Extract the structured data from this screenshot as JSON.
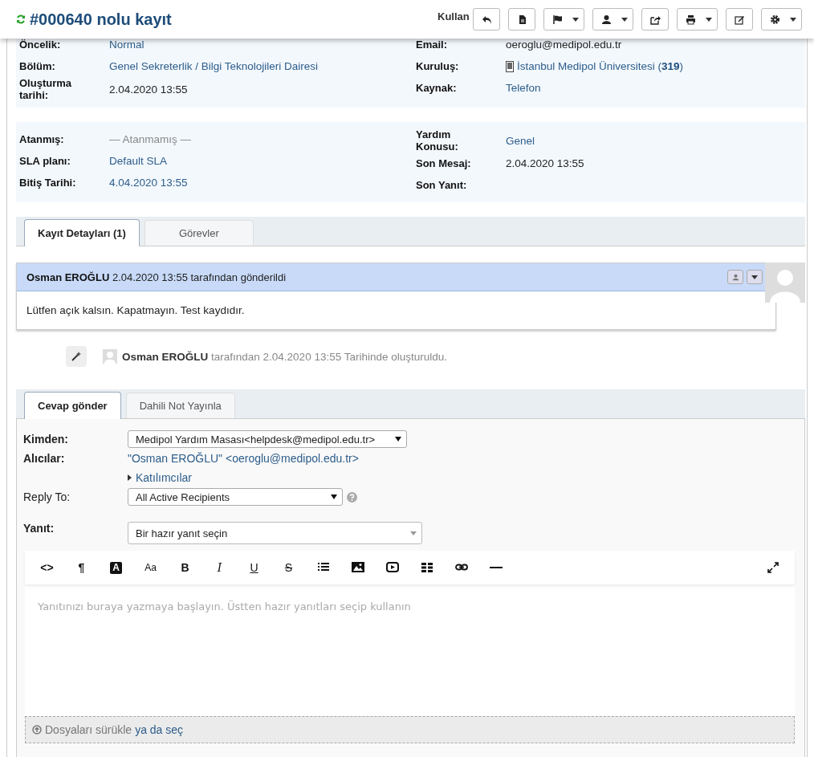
{
  "header": {
    "title": "#000640 nolu kayıt",
    "hidden_label": "Kullan",
    "buttons": [
      {
        "kind": "reply",
        "caret": false
      },
      {
        "kind": "document",
        "caret": false
      },
      {
        "kind": "flag",
        "caret": true
      },
      {
        "kind": "person",
        "caret": true
      },
      {
        "kind": "share",
        "caret": false
      },
      {
        "kind": "print",
        "caret": true
      },
      {
        "kind": "edit",
        "caret": false
      },
      {
        "kind": "gear",
        "caret": true
      }
    ]
  },
  "info_blocks": [
    {
      "left": [
        {
          "label": "Öncelik:",
          "value": "Normal",
          "kind": "link"
        },
        {
          "label": "Bölüm:",
          "value": "Genel Sekreterlik / Bilgi Teknolojileri Dairesi",
          "kind": "link"
        },
        {
          "label": "Oluşturma tarihi:",
          "value": "2.04.2020 13:55",
          "kind": "plain"
        }
      ],
      "right": [
        {
          "label": "Email:",
          "value": "oeroglu@medipol.edu.tr",
          "kind": "plain"
        },
        {
          "label": "Kuruluş:",
          "value": "İstanbul Medipol Üniversitesi (**319**)",
          "kind": "org"
        },
        {
          "label": "Kaynak:",
          "value": "Telefon",
          "kind": "link"
        }
      ]
    },
    {
      "left": [
        {
          "label": "Atanmış:",
          "value": "— Atanmamış —",
          "kind": "muted"
        },
        {
          "label": "SLA planı:",
          "value": "Default SLA",
          "kind": "link"
        },
        {
          "label": "Bitiş Tarihi:",
          "value": "4.04.2020 13:55",
          "kind": "link"
        }
      ],
      "right": [
        {
          "label": "Yardım Konusu:",
          "value": "Genel",
          "kind": "link"
        },
        {
          "label": "Son Mesaj:",
          "value": "2.04.2020 13:55",
          "kind": "plain"
        },
        {
          "label": "Son Yanıt:"
        }
      ]
    }
  ],
  "thread_tabs": [
    {
      "label": "Kayıt Detayları (1)",
      "selected": true
    },
    {
      "label": "Görevler",
      "selected": false
    }
  ],
  "message": {
    "header": "**Osman EROĞLU** 2.04.2020 13:55 tarafından gönderildi",
    "body": "Lütfen açık kalsın. Kapatmayın. Test kaydıdır."
  },
  "event": {
    "text": "**Osman EROĞLU** tarafından 2.04.2020 13:55 Tarihinde oluşturuldu."
  },
  "reply_tabs": [
    {
      "label": "Cevap gönder",
      "selected": true
    },
    {
      "label": "Dahili Not Yayınla",
      "selected": false
    }
  ],
  "form": {
    "from": {
      "label": "Kimden:",
      "value": "Medipol Yardım Masası<helpdesk@medipol.edu.tr>"
    },
    "recipients": {
      "label": "Alıcılar:",
      "value": "\"Osman EROĞLU\" <oeroglu@medipol.edu.tr>",
      "collaborators": "Katılımcılar"
    },
    "reply_to": {
      "label": "Reply To:",
      "value": "All Active Recipients"
    },
    "response": {
      "label": "Yanıt:",
      "value": "Bir hazır yanıt seçin"
    }
  },
  "editor": {
    "tools": [
      {
        "kind": "text",
        "label": "<>"
      },
      {
        "kind": "text",
        "label": "¶"
      },
      {
        "kind": "boxed",
        "label": "A"
      },
      {
        "kind": "small",
        "label": "Aa"
      },
      {
        "kind": "bold",
        "label": "B"
      },
      {
        "kind": "italic",
        "label": "I"
      },
      {
        "kind": "underline",
        "label": "U"
      },
      {
        "kind": "strike",
        "label": "S"
      },
      {
        "kind": "list"
      },
      {
        "kind": "image"
      },
      {
        "kind": "video"
      },
      {
        "kind": "table"
      },
      {
        "kind": "link"
      },
      {
        "kind": "rule"
      }
    ],
    "placeholder": "Yanıtınızı buraya yazmaya başlayın. Üstten hazır yanıtları seçip kullanın",
    "dropzone": {
      "text": "Dosyaları sürükle",
      "link": "ya da seç"
    }
  }
}
